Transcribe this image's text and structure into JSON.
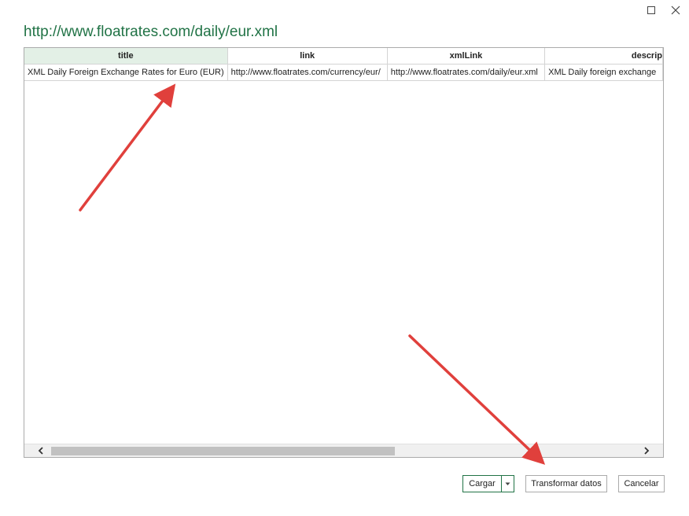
{
  "window": {
    "maximize_icon": "maximize-icon",
    "close_icon": "close-icon"
  },
  "header": {
    "title": "http://www.floatrates.com/daily/eur.xml"
  },
  "table": {
    "columns": [
      "title",
      "link",
      "xmlLink",
      "descrip"
    ],
    "rows": [
      [
        "XML Daily Foreign Exchange Rates for Euro (EUR)",
        "http://www.floatrates.com/currency/eur/",
        "http://www.floatrates.com/daily/eur.xml",
        "XML Daily foreign exchange"
      ]
    ]
  },
  "buttons": {
    "load": "Cargar",
    "transform": "Transformar datos",
    "cancel": "Cancelar"
  },
  "colors": {
    "accent": "#217346",
    "header_selected": "#e3f0e6",
    "annotation_arrow": "#e0403c"
  }
}
